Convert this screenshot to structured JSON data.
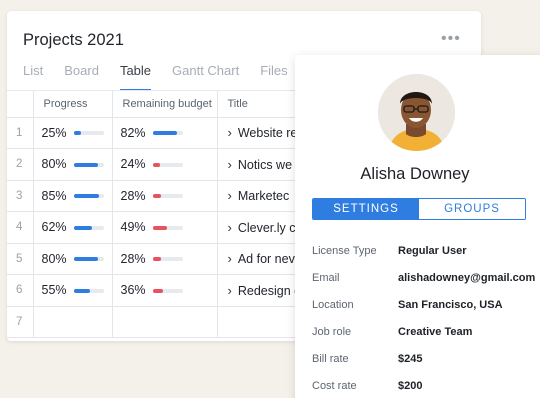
{
  "projects": {
    "title": "Projects 2021",
    "more_icon": "•••",
    "tabs": [
      {
        "label": "List",
        "active": false
      },
      {
        "label": "Board",
        "active": false
      },
      {
        "label": "Table",
        "active": true
      },
      {
        "label": "Gantt Chart",
        "active": false
      },
      {
        "label": "Files",
        "active": false
      }
    ],
    "columns": {
      "progress": "Progress",
      "budget": "Remaining budget",
      "title": "Title"
    },
    "rows": [
      {
        "num": "1",
        "progress": "25%",
        "progress_value": 0.25,
        "budget": "82%",
        "budget_value": 0.82,
        "budget_status": "ok",
        "title": "Website re"
      },
      {
        "num": "2",
        "progress": "80%",
        "progress_value": 0.8,
        "budget": "24%",
        "budget_value": 0.24,
        "budget_status": "low",
        "title": "Notics we"
      },
      {
        "num": "3",
        "progress": "85%",
        "progress_value": 0.85,
        "budget": "28%",
        "budget_value": 0.28,
        "budget_status": "low",
        "title": "Marketec"
      },
      {
        "num": "4",
        "progress": "62%",
        "progress_value": 0.62,
        "budget": "49%",
        "budget_value": 0.49,
        "budget_status": "low",
        "title": "Clever.ly c"
      },
      {
        "num": "5",
        "progress": "80%",
        "progress_value": 0.8,
        "budget": "28%",
        "budget_value": 0.28,
        "budget_status": "low",
        "title": "Ad for nev"
      },
      {
        "num": "6",
        "progress": "55%",
        "progress_value": 0.55,
        "budget": "36%",
        "budget_value": 0.36,
        "budget_status": "low",
        "title": "Redesign c"
      },
      {
        "num": "7",
        "progress": "",
        "progress_value": null,
        "budget": "",
        "budget_value": null,
        "budget_status": "",
        "title": ""
      }
    ]
  },
  "profile": {
    "name": "Alisha Downey",
    "toggle": {
      "settings": "SETTINGS",
      "groups": "GROUPS",
      "active": "settings"
    },
    "details": [
      {
        "label": "License Type",
        "value": "Regular User"
      },
      {
        "label": "Email",
        "value": "alishadowney@gmail.com"
      },
      {
        "label": "Location",
        "value": "San Francisco, USA"
      },
      {
        "label": "Job role",
        "value": "Creative Team"
      },
      {
        "label": "Bill rate",
        "value": "$245"
      },
      {
        "label": "Cost rate",
        "value": "$200"
      }
    ]
  },
  "colors": {
    "accent": "#2f7de1",
    "low_budget": "#e8525d",
    "background": "#f4f1ea"
  },
  "icons": {
    "more": "more-icon",
    "chevron": "chevron-right-icon",
    "avatar": "avatar"
  }
}
